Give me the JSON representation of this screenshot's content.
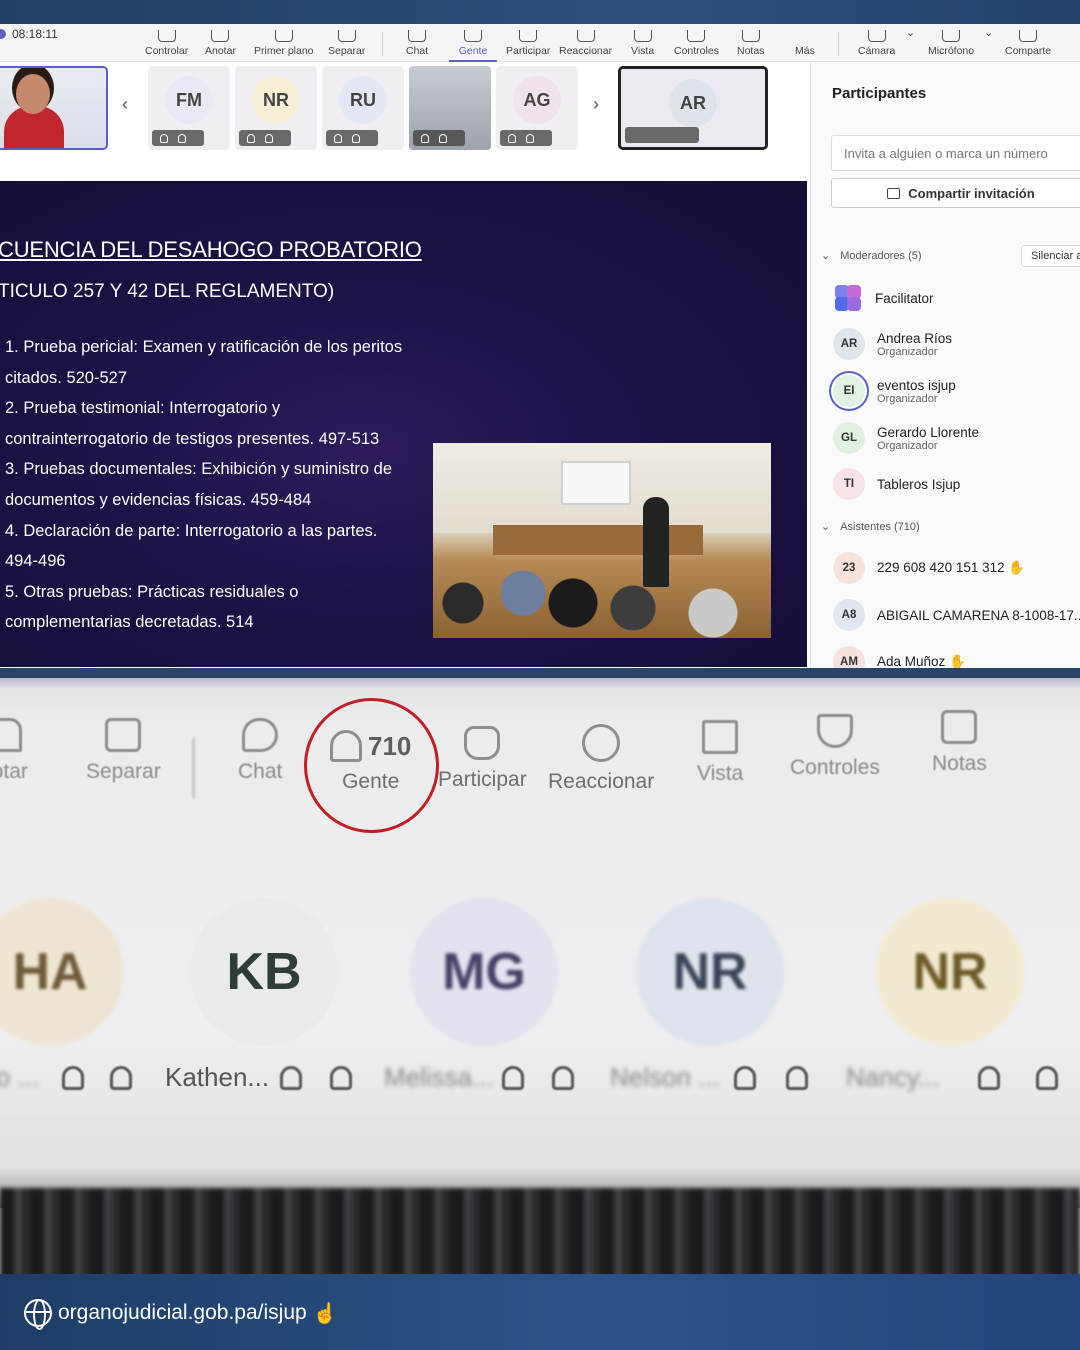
{
  "meeting": {
    "clock": "08:18:11",
    "toolbar": [
      {
        "label": "Controlar",
        "icon": "control-icon"
      },
      {
        "label": "Anotar",
        "icon": "annotate-icon"
      },
      {
        "label": "Primer plano",
        "icon": "spotlight-icon"
      },
      {
        "label": "Separar",
        "icon": "popout-icon"
      },
      {
        "label": "Chat",
        "icon": "chat-icon"
      },
      {
        "label": "Gente",
        "icon": "people-icon",
        "active": true
      },
      {
        "label": "Participar",
        "icon": "raise-hand-icon"
      },
      {
        "label": "Reaccionar",
        "icon": "react-icon"
      },
      {
        "label": "Vista",
        "icon": "view-icon"
      },
      {
        "label": "Controles",
        "icon": "controls-icon"
      },
      {
        "label": "Notas",
        "icon": "notes-icon"
      },
      {
        "label": "Más",
        "icon": "more-icon"
      },
      {
        "label": "Cámara",
        "icon": "camera-icon"
      },
      {
        "label": "Micrófono",
        "icon": "mic-icon"
      },
      {
        "label": "Comparte",
        "icon": "share-icon"
      }
    ],
    "tiles": [
      {
        "initials": "FM",
        "color": "#ece7f3"
      },
      {
        "initials": "NR",
        "color": "#f6efd6"
      },
      {
        "initials": "RU",
        "color": "#e4e7f4"
      },
      {
        "initials": "",
        "color": "#cfd3da"
      },
      {
        "initials": "AG",
        "color": "#f0e3ee"
      }
    ],
    "featured_tile": {
      "initials": "AR"
    }
  },
  "slide": {
    "title": "CUENCIA DEL DESAHOGO PROBATORIO",
    "subtitle": "TICULO 257 Y 42 DEL REGLAMENTO)",
    "items": [
      "1. Prueba pericial: Examen y ratificación de los peritos",
      "citados. 520-527",
      "2. Prueba testimonial: Interrogatorio y",
      "contrainterrogatorio de testigos presentes. 497-513",
      "3. Pruebas documentales: Exhibición y suministro de",
      "documentos y evidencias físicas. 459-484",
      "4. Declaración de parte: Interrogatorio a las partes.",
      "494-496",
      "5. Otras pruebas: Prácticas residuales o",
      "complementarias decretadas. 514"
    ]
  },
  "participants": {
    "title": "Participantes",
    "invite_placeholder": "Invita a alguien o marca un número",
    "share_label": "Compartir invitación",
    "moderators_header": "Moderadores (5)",
    "mute_label": "Silenciar a",
    "attendees_header": "Asistentes (710)",
    "moderators": [
      {
        "initials": "",
        "name": "Facilitator",
        "role": "",
        "color": "#ffffff"
      },
      {
        "initials": "AR",
        "name": "Andrea Ríos",
        "role": "Organizador",
        "color": "#e1e5ec"
      },
      {
        "initials": "EI",
        "name": "eventos isjup",
        "role": "Organizador",
        "color": "#dff2e3"
      },
      {
        "initials": "GL",
        "name": "Gerardo Llorente",
        "role": "Organizador",
        "color": "#e0f1e2"
      },
      {
        "initials": "TI",
        "name": "Tableros Isjup",
        "role": "",
        "color": "#f8e3e6"
      }
    ],
    "attendees": [
      {
        "initials": "23",
        "name": "229 608 420 151 312",
        "color": "#f7e3dc"
      },
      {
        "initials": "A8",
        "name": "ABIGAIL CAMARENA 8-1008-17...",
        "color": "#e1e6f0"
      },
      {
        "initials": "AM",
        "name": "Ada Muñoz",
        "color": "#f6e2da"
      }
    ]
  },
  "zoomed": {
    "toolbar": [
      {
        "label": "notar",
        "icon": "annotate-icon"
      },
      {
        "label": "Separar",
        "icon": "popout-icon"
      },
      {
        "label": "Chat",
        "icon": "chat-icon"
      },
      {
        "label": "Gente",
        "icon": "people-icon",
        "count": "710"
      },
      {
        "label": "Participar",
        "icon": "raise-hand-icon"
      },
      {
        "label": "Reaccionar",
        "icon": "react-icon"
      },
      {
        "label": "Vista",
        "icon": "view-icon"
      },
      {
        "label": "Controles",
        "icon": "controls-icon"
      },
      {
        "label": "Notas",
        "icon": "notes-icon"
      }
    ],
    "avatars": [
      {
        "initials": "HA",
        "name": "o ...",
        "color": "#eee6d4"
      },
      {
        "initials": "KB",
        "name": "Kathen...",
        "color": "#e9eaec"
      },
      {
        "initials": "MG",
        "name": "Melissa...",
        "color": "#e5e1ee"
      },
      {
        "initials": "NR",
        "name": "Nelson ...",
        "color": "#dfe4ec"
      },
      {
        "initials": "NR",
        "name": "Nancy...",
        "color": "#f2ead0"
      }
    ]
  },
  "footer": {
    "url": "organojudicial.gob.pa/isjup"
  }
}
